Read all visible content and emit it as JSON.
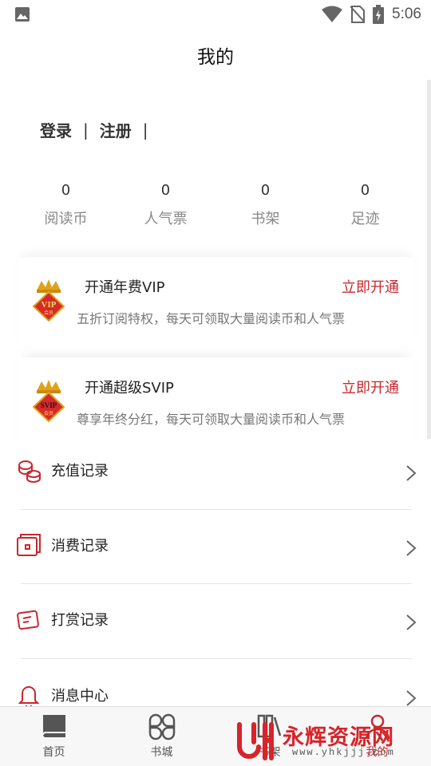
{
  "status_bar": {
    "time": "5:06",
    "icons": [
      "image-icon",
      "wifi-icon",
      "no-sim-icon",
      "battery-charging-icon"
    ]
  },
  "header": {
    "title": "我的"
  },
  "auth": {
    "login_label": "登录",
    "separator": "|",
    "register_label": "注册",
    "separator_end": "|"
  },
  "stats": [
    {
      "value": "0",
      "label": "阅读币"
    },
    {
      "value": "0",
      "label": "人气票"
    },
    {
      "value": "0",
      "label": "书架"
    },
    {
      "value": "0",
      "label": "足迹"
    }
  ],
  "vip_cards": [
    {
      "badge_text": "VIP",
      "badge_subtext": "会员",
      "title": "开通年费VIP",
      "action": "立即开通",
      "description": "五折订阅特权，每天可领取大量阅读币和人气票"
    },
    {
      "badge_text": "SVIP",
      "badge_subtext": "会员",
      "title": "开通超级SVIP",
      "action": "立即开通",
      "description": "尊享年终分红，每天可领取大量阅读币和人气票"
    }
  ],
  "menu": [
    {
      "label": "充值记录",
      "icon": "coins-icon"
    },
    {
      "label": "消费记录",
      "icon": "wallet-icon"
    },
    {
      "label": "打赏记录",
      "icon": "reward-card-icon"
    },
    {
      "label": "消息中心",
      "icon": "bell-icon"
    }
  ],
  "bottom_nav": [
    {
      "label": "首页",
      "icon": "book-icon"
    },
    {
      "label": "书城",
      "icon": "grid-icon"
    },
    {
      "label": "书架",
      "icon": "bookshelf-icon"
    },
    {
      "label": "我的",
      "icon": "user-icon"
    }
  ],
  "watermark": {
    "text": "永辉资源网",
    "url": "www.yhkjjj.com"
  },
  "colors": {
    "accent": "#c8282d",
    "text": "#222222",
    "muted": "#888888",
    "nav_bg": "#f7f7f7",
    "gold": "#e0a21a"
  }
}
